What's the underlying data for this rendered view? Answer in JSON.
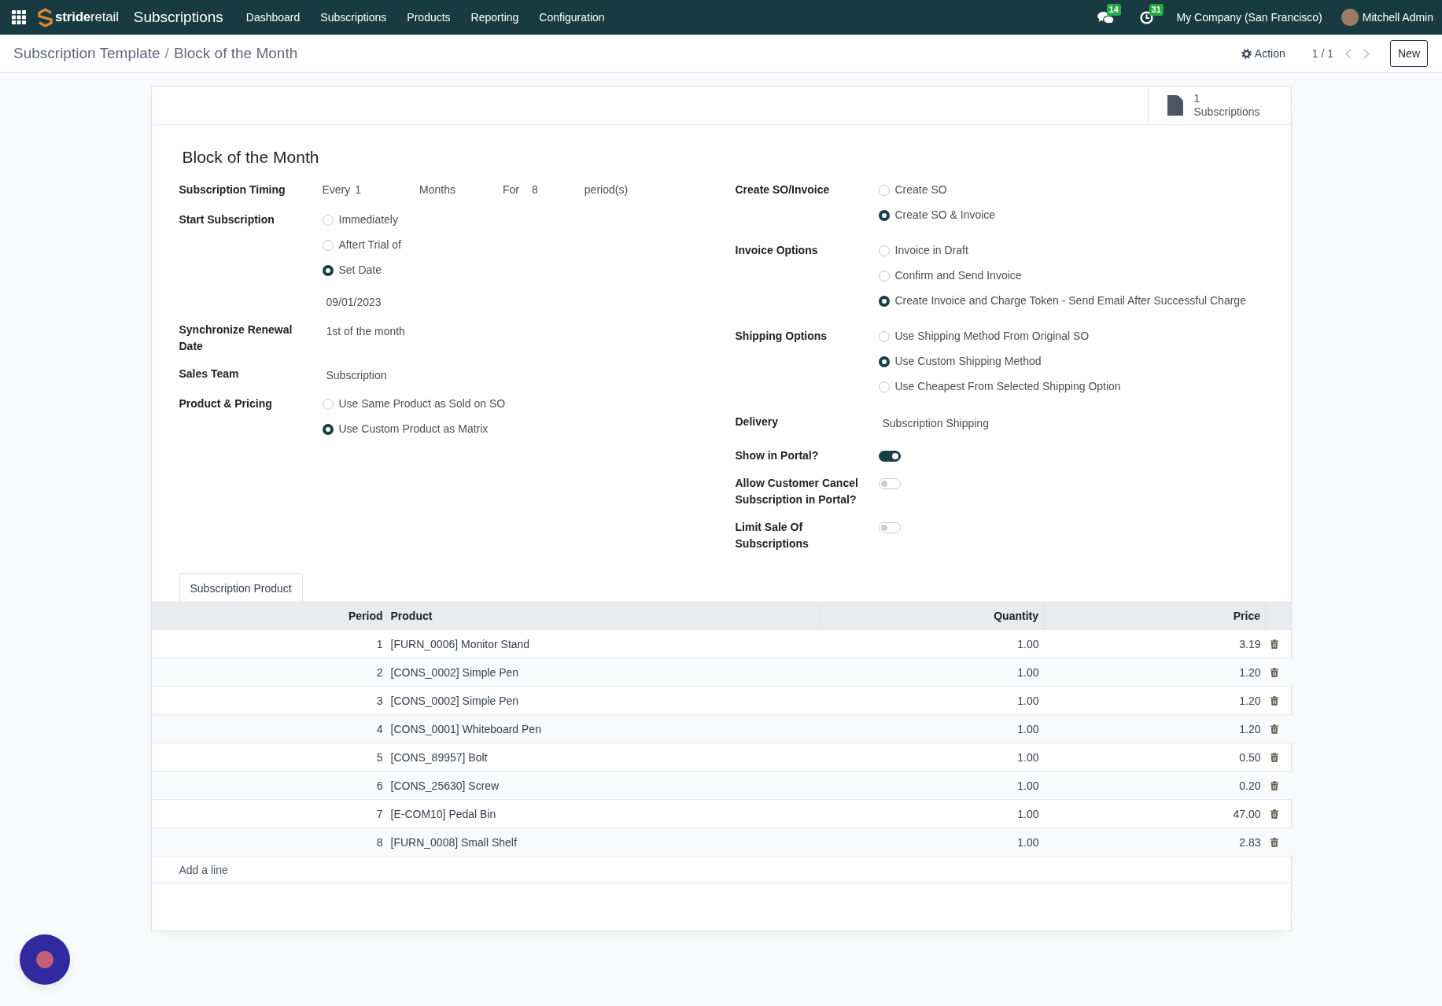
{
  "navbar": {
    "brand": "**stride**retail",
    "app_name": "Subscriptions",
    "menu": [
      "Dashboard",
      "Subscriptions",
      "Products",
      "Reporting",
      "Configuration"
    ],
    "messages_badge": "14",
    "activities_badge": "31",
    "company": "My Company (San Francisco)",
    "user": "Mitchell Admin"
  },
  "control_panel": {
    "breadcrumbs": [
      {
        "label": "Subscription Template"
      },
      {
        "label": "Block of the Month"
      }
    ],
    "separator": "/",
    "action": "Action",
    "pager": "1 / 1",
    "new_button": "New"
  },
  "stat_buttons": [
    {
      "count": "1",
      "label": "Subscriptions"
    }
  ],
  "form": {
    "title": "Block of the Month",
    "left": [
      {
        "kind": "timing",
        "label": "Subscription Timing",
        "every": "Every",
        "interval": "1",
        "unit": "Months",
        "for_label": "For",
        "periods": "8",
        "suffix": "period(s)"
      },
      {
        "kind": "radio",
        "label": "Start Subscription",
        "options": [
          {
            "label": "Immediately",
            "selected": false
          },
          {
            "label": "Aftert Trial of",
            "selected": false
          },
          {
            "label": "Set Date",
            "selected": true
          }
        ],
        "value": "09/01/2023"
      },
      {
        "kind": "text",
        "label": "Synchronize Renewal Date",
        "value": "1st of the month"
      },
      {
        "kind": "text",
        "label": "Sales Team",
        "value": "Subscription"
      },
      {
        "kind": "radio",
        "label": "Product & Pricing",
        "options": [
          {
            "label": "Use Same Product as Sold on SO",
            "selected": false
          },
          {
            "label": "Use Custom Product as Matrix",
            "selected": true
          }
        ]
      }
    ],
    "right": [
      {
        "kind": "radio",
        "label": "Create SO/Invoice",
        "options": [
          {
            "label": "Create SO",
            "selected": false
          },
          {
            "label": "Create SO & Invoice",
            "selected": true
          }
        ]
      },
      {
        "kind": "radio",
        "label": "Invoice Options",
        "options": [
          {
            "label": "Invoice in Draft",
            "selected": false
          },
          {
            "label": "Confirm and Send Invoice",
            "selected": false
          },
          {
            "label": "Create Invoice and Charge Token - Send Email After Successful Charge",
            "selected": true
          }
        ]
      },
      {
        "kind": "radio",
        "label": "Shipping Options",
        "options": [
          {
            "label": "Use Shipping Method From Original SO",
            "selected": false
          },
          {
            "label": "Use Custom Shipping Method",
            "selected": true
          },
          {
            "label": "Use Cheapest From Selected Shipping Option",
            "selected": false
          }
        ]
      },
      {
        "kind": "text",
        "label": "Delivery",
        "value": "Subscription Shipping"
      },
      {
        "kind": "toggle",
        "label": "Show in Portal?",
        "on": true
      },
      {
        "kind": "toggle",
        "label": "Allow Customer Cancel Subscription in Portal?",
        "on": false
      },
      {
        "kind": "toggle",
        "label": "Limit Sale Of Subscriptions",
        "on": false
      }
    ]
  },
  "tabs": [
    {
      "label": "Subscription Product",
      "selected": true
    }
  ],
  "table": {
    "columns": [
      "Period",
      "Product",
      "Quantity",
      "Price"
    ],
    "rows": [
      {
        "period": "1",
        "product": "[FURN_0006] Monitor Stand",
        "quantity": "1.00",
        "price": "3.19"
      },
      {
        "period": "2",
        "product": "[CONS_0002] Simple Pen",
        "quantity": "1.00",
        "price": "1.20"
      },
      {
        "period": "3",
        "product": "[CONS_0002] Simple Pen",
        "quantity": "1.00",
        "price": "1.20"
      },
      {
        "period": "4",
        "product": "[CONS_0001] Whiteboard Pen",
        "quantity": "1.00",
        "price": "1.20"
      },
      {
        "period": "5",
        "product": "[CONS_89957] Bolt",
        "quantity": "1.00",
        "price": "0.50"
      },
      {
        "period": "6",
        "product": "[CONS_25630] Screw",
        "quantity": "1.00",
        "price": "0.20"
      },
      {
        "period": "7",
        "product": "[E-COM10] Pedal Bin",
        "quantity": "1.00",
        "price": "47.00"
      },
      {
        "period": "8",
        "product": "[FURN_0008] Small Shelf",
        "quantity": "1.00",
        "price": "2.83"
      }
    ],
    "add_line": "Add a line"
  }
}
